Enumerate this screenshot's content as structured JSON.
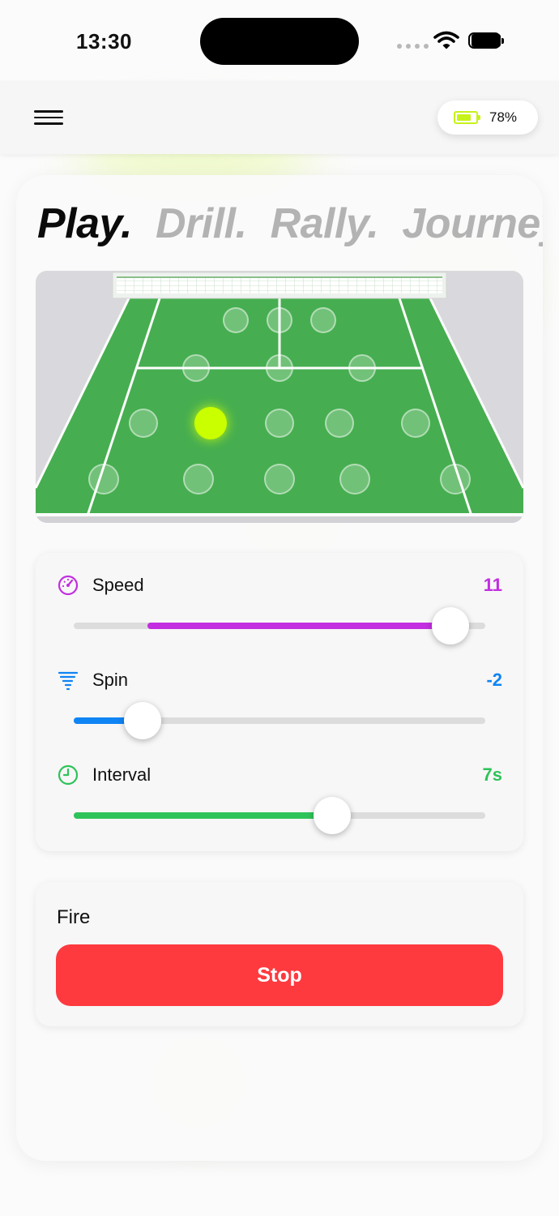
{
  "status_bar": {
    "time": "13:30"
  },
  "header": {
    "battery_text": "78%",
    "battery_level": 0.78
  },
  "tabs": [
    {
      "label": "Play.",
      "active": true
    },
    {
      "label": "Drill.",
      "active": false
    },
    {
      "label": "Rally.",
      "active": false
    },
    {
      "label": "Journey",
      "active": false
    }
  ],
  "court": {
    "colors": {
      "surface": "#46ae50",
      "lines": "#ffffff",
      "surround": "#d9d9dd",
      "active_target": "#caff00"
    },
    "target_rows": [
      {
        "count": 3,
        "active_index": null
      },
      {
        "count": 3,
        "active_index": null
      },
      {
        "count": 5,
        "active_index": 1
      },
      {
        "count": 5,
        "active_index": null
      }
    ]
  },
  "settings": {
    "speed": {
      "label": "Speed",
      "value": "11",
      "level": 0.915,
      "fill_from": 0.18,
      "color": "#c22ee0",
      "icon": "speedometer-icon"
    },
    "spin": {
      "label": "Spin",
      "value": "-2",
      "level": 0.167,
      "fill_from": 0.0,
      "color": "#0f84f4",
      "icon": "tornado-icon"
    },
    "interval": {
      "label": "Interval",
      "value": "7s",
      "level": 0.627,
      "fill_from": 0.0,
      "color": "#2ec35a",
      "icon": "clock-icon"
    }
  },
  "fire": {
    "title": "Fire",
    "button_label": "Stop"
  }
}
